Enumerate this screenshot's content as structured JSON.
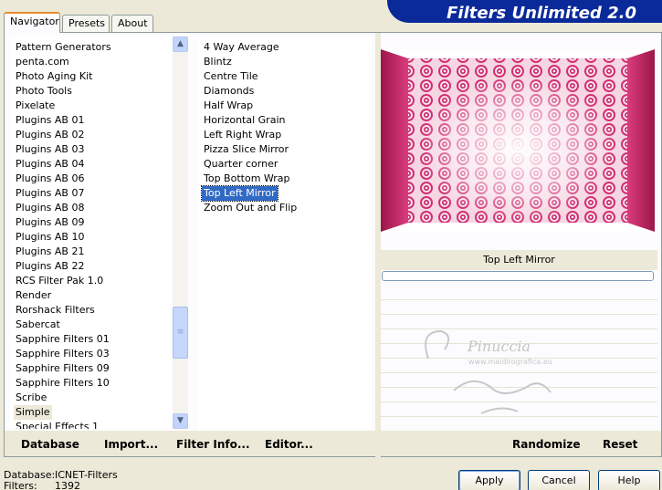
{
  "tabs": [
    {
      "label": "Navigator",
      "active": true
    },
    {
      "label": "Presets",
      "active": false
    },
    {
      "label": "About",
      "active": false
    }
  ],
  "banner": {
    "title": "Filters Unlimited 2.0",
    "color": "#0a2a9a"
  },
  "categories": {
    "items": [
      "Pattern Generators",
      "penta.com",
      "Photo Aging Kit",
      "Photo Tools",
      "Pixelate",
      "Plugins AB 01",
      "Plugins AB 02",
      "Plugins AB 03",
      "Plugins AB 04",
      "Plugins AB 06",
      "Plugins AB 07",
      "Plugins AB 08",
      "Plugins AB 09",
      "Plugins AB 10",
      "Plugins AB 21",
      "Plugins AB 22",
      "RCS Filter Pak 1.0",
      "Render",
      "Rorshack Filters",
      "Sabercat",
      "Sapphire Filters 01",
      "Sapphire Filters 03",
      "Sapphire Filters 09",
      "Sapphire Filters 10",
      "Scribe",
      "Simple",
      "Special Effects 1"
    ],
    "selected": "Simple"
  },
  "filters": {
    "items": [
      "4 Way Average",
      "Blintz",
      "Centre Tile",
      "Diamonds",
      "Half Wrap",
      "Horizontal Grain",
      "Left Right Wrap",
      "Pizza Slice Mirror",
      "Quarter corner",
      "Top Bottom Wrap",
      "Top Left Mirror",
      "Zoom Out and Flip"
    ],
    "selected": "Top Left Mirror"
  },
  "preview": {
    "caption": "Top Left Mirror",
    "watermark_line1": "Pinuccia",
    "watermark_line2": "www.maidirografica.eu"
  },
  "toolbar": {
    "database": "Database",
    "import": "Import...",
    "filter_info": "Filter Info...",
    "editor": "Editor...",
    "randomize": "Randomize",
    "reset": "Reset"
  },
  "status": {
    "database_label": "Database:",
    "database_value": "ICNET-Filters",
    "filters_label": "Filters:",
    "filters_value": "1392"
  },
  "dialog": {
    "apply": "Apply",
    "cancel": "Cancel",
    "help": "Help"
  }
}
